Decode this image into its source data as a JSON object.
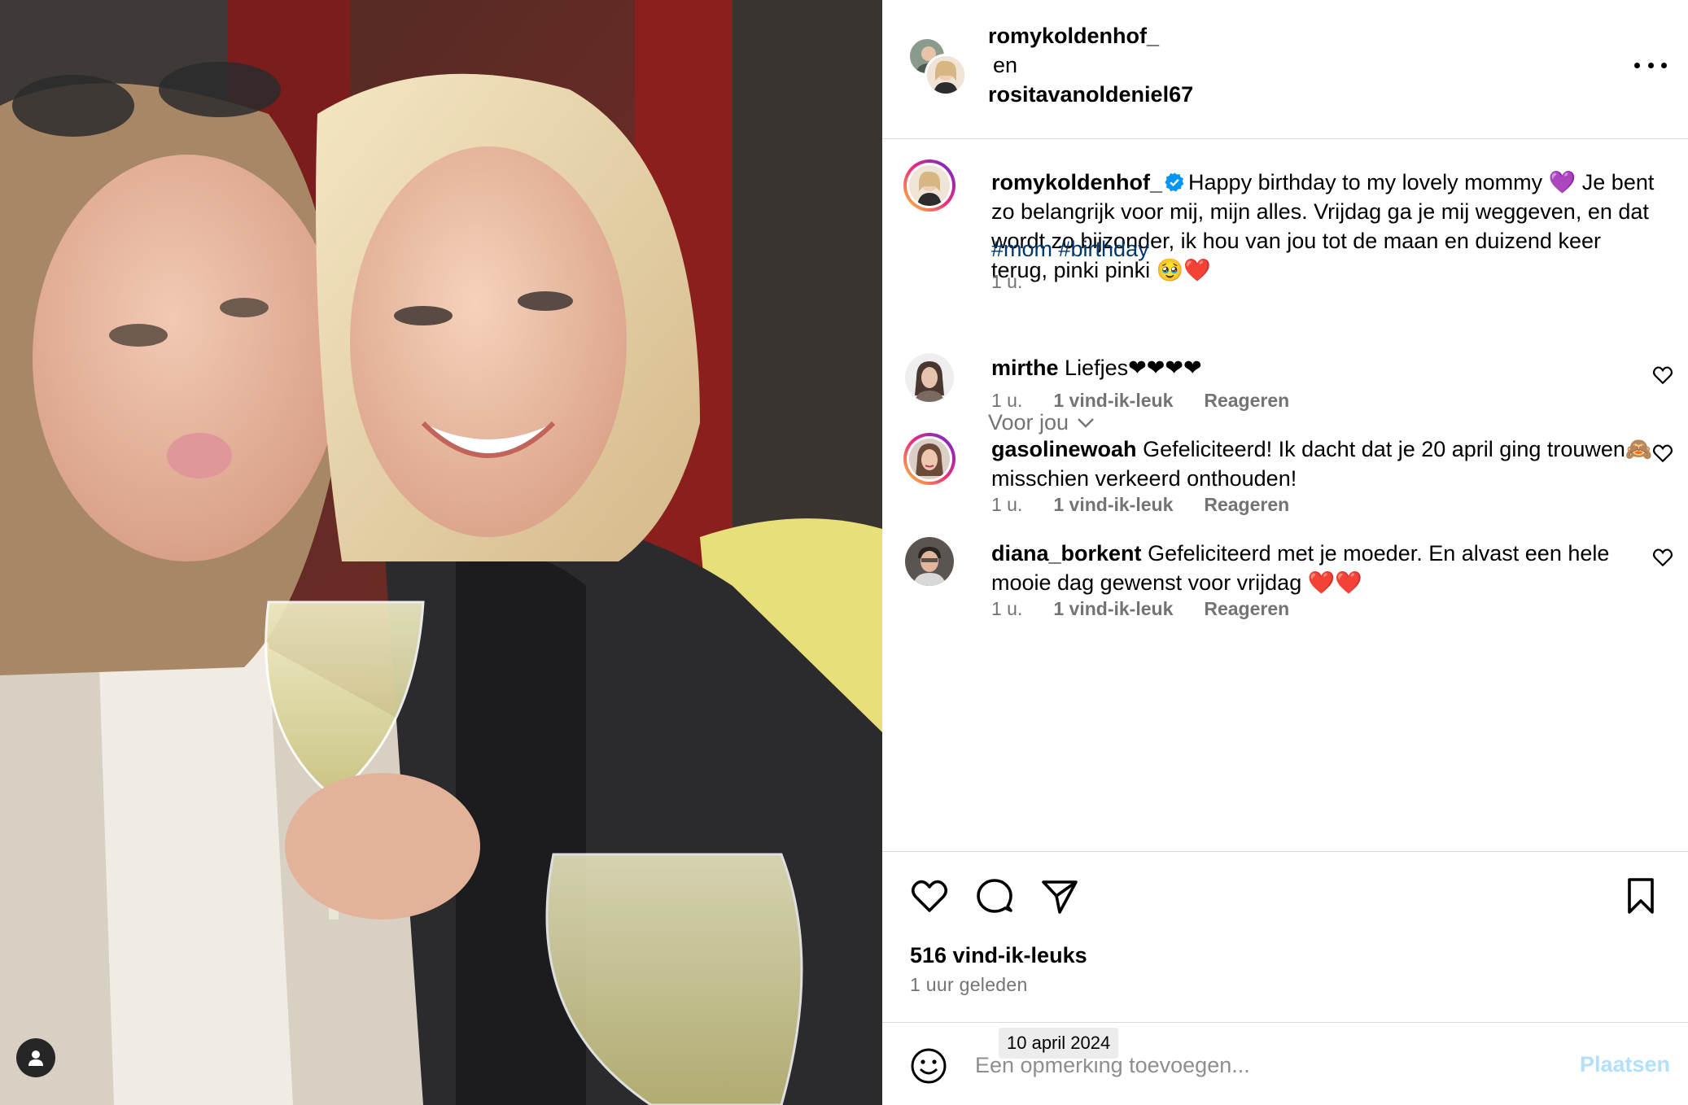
{
  "post": {
    "owner": "romykoldenhof_",
    "joiner": "en",
    "collaborator": "rositavanoldeniel67",
    "caption_user": "romykoldenhof_",
    "caption": "Happy birthday to my lovely mommy 💜 Je bent zo belangrijk voor mij, mijn alles. Vrijdag ga je mij weggeven, en dat wordt zo bijzonder, ik hou van jou tot de maan en duizend keer terug, pinki pinki 🥹❤️",
    "hashtags": "#mom #birthday",
    "caption_time": "1 u."
  },
  "filter": {
    "label": "Voor jou"
  },
  "comments": [
    {
      "user": "mirthe",
      "text": "Liefjes❤❤❤❤",
      "time": "1 u.",
      "likes": "1 vind-ik-leuk",
      "reply": "Reageren"
    },
    {
      "user": "gasolinewoah",
      "text": "Gefeliciteerd! Ik dacht dat je 20 april ging trouwen🙈 misschien verkeerd onthouden!",
      "time": "1 u.",
      "likes": "1 vind-ik-leuk",
      "reply": "Reageren"
    },
    {
      "user": "diana_borkent",
      "text": "Gefeliciteerd met je moeder. En alvast een hele mooie dag gewenst voor vrijdag ❤️❤️",
      "time": "1 u.",
      "likes": "1 vind-ik-leuk",
      "reply": "Reageren"
    }
  ],
  "stats": {
    "likes": "516 vind-ik-leuks",
    "ago": "1 uur geleden",
    "date_tooltip": "10 april 2024"
  },
  "composer": {
    "placeholder": "Een opmerking toevoegen...",
    "post_label": "Plaatsen"
  },
  "icons": {
    "like": "heart-icon",
    "comment": "comment-bubble-icon",
    "share": "send-plane-icon",
    "save": "bookmark-icon",
    "emoji": "smiley-icon",
    "more": "more-horizontal-icon",
    "tag": "user-tag-icon",
    "verified": "verified-badge-icon"
  },
  "colors": {
    "link": "#00376b",
    "muted": "#737373",
    "post_disabled": "#b2dffc",
    "verified": "#0095f6"
  }
}
